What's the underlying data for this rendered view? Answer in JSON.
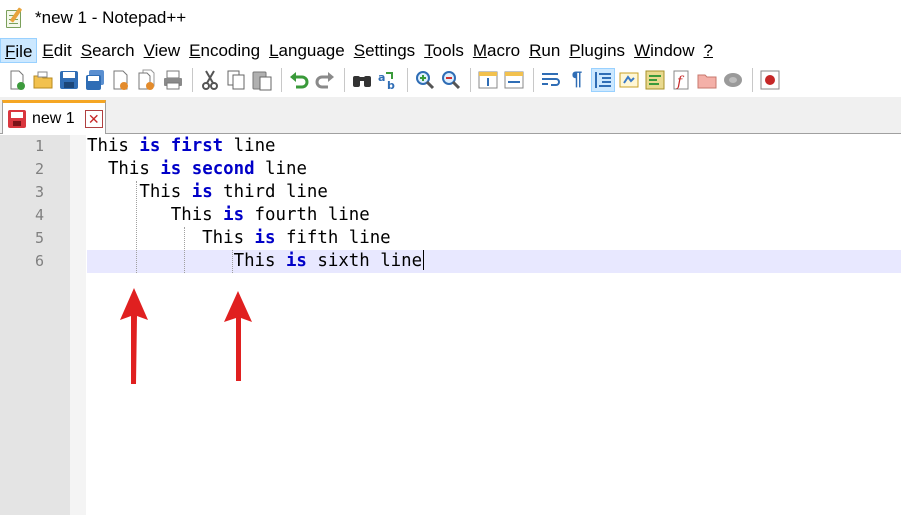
{
  "window": {
    "title": "*new 1 - Notepad++"
  },
  "menu": {
    "items": [
      {
        "label": "File",
        "active": true
      },
      {
        "label": "Edit"
      },
      {
        "label": "Search"
      },
      {
        "label": "View"
      },
      {
        "label": "Encoding"
      },
      {
        "label": "Language"
      },
      {
        "label": "Settings"
      },
      {
        "label": "Tools"
      },
      {
        "label": "Macro"
      },
      {
        "label": "Run"
      },
      {
        "label": "Plugins"
      },
      {
        "label": "Window"
      },
      {
        "label": "?"
      }
    ]
  },
  "toolbar": {
    "icons": [
      "new-file-icon",
      "open-file-icon",
      "save-icon",
      "save-all-icon",
      "close-icon",
      "close-all-icon",
      "print-icon",
      "cut-icon",
      "copy-icon",
      "paste-icon",
      "undo-icon",
      "redo-icon",
      "find-icon",
      "replace-icon",
      "zoom-in-icon",
      "zoom-out-icon",
      "sync-vertical-icon",
      "sync-horizontal-icon",
      "word-wrap-icon",
      "show-all-characters-icon",
      "indent-guide-icon",
      "user-defined-language-icon",
      "document-map-icon",
      "function-list-icon",
      "folder-as-workspace-icon",
      "monitoring-icon",
      "record-macro-icon"
    ]
  },
  "tab": {
    "label": "new 1"
  },
  "editor": {
    "line_numbers": [
      "1",
      "2",
      "3",
      "4",
      "5",
      "6"
    ],
    "lines": [
      {
        "indent": "",
        "pre": "This ",
        "kw1": "is",
        "mid": " ",
        "kw2": "first",
        "post": " line"
      },
      {
        "indent": "  ",
        "pre": "This ",
        "kw1": "is",
        "mid": " ",
        "kw2": "second",
        "post": " line"
      },
      {
        "indent": "     ",
        "pre": "This ",
        "kw1": "is",
        "mid": " third line",
        "kw2": "",
        "post": ""
      },
      {
        "indent": "        ",
        "pre": "This ",
        "kw1": "is",
        "mid": " fourth line",
        "kw2": "",
        "post": ""
      },
      {
        "indent": "           ",
        "pre": "This ",
        "kw1": "is",
        "mid": " fifth line",
        "kw2": "",
        "post": ""
      },
      {
        "indent": "              ",
        "pre": "This ",
        "kw1": "is",
        "mid": " sixth line",
        "kw2": "",
        "post": ""
      }
    ],
    "current_line": 6,
    "colors": {
      "keyword": "#0000c8",
      "current_line_bg": "#e8e8ff",
      "gutter_bg": "#e4e4e4"
    }
  },
  "annotations": {
    "arrow_color": "#e02020",
    "arrow_count": 2
  }
}
